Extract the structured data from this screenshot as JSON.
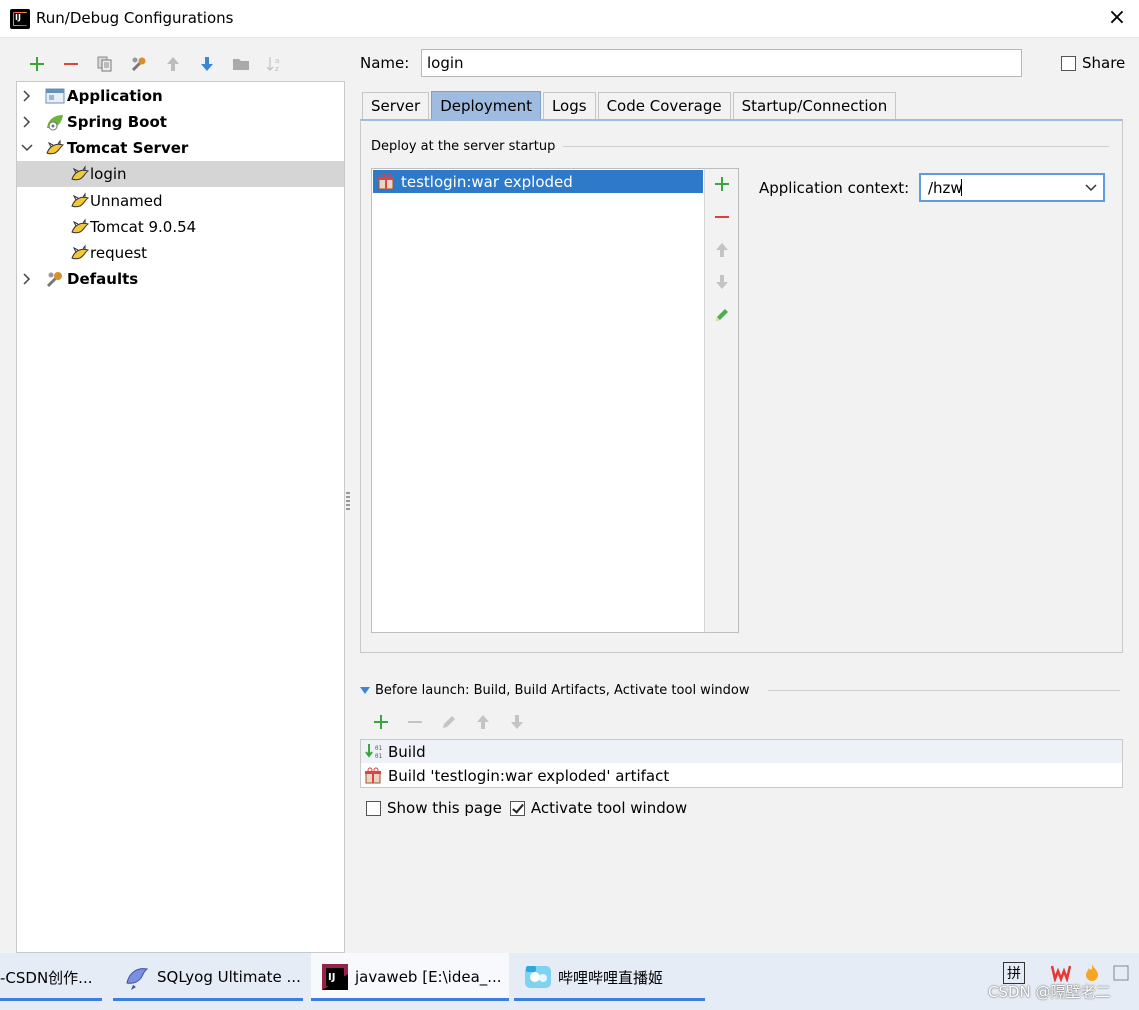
{
  "window": {
    "title": "Run/Debug Configurations",
    "close_label": "×"
  },
  "tree": {
    "items": [
      {
        "label": "Application",
        "bold": true,
        "expanded": false
      },
      {
        "label": "Spring Boot",
        "bold": true,
        "expanded": false
      },
      {
        "label": "Tomcat Server",
        "bold": true,
        "expanded": true
      },
      {
        "label": "login",
        "bold": false,
        "selected": true
      },
      {
        "label": "Unnamed",
        "bold": false
      },
      {
        "label": "Tomcat 9.0.54",
        "bold": false
      },
      {
        "label": "request",
        "bold": false
      },
      {
        "label": "Defaults",
        "bold": true,
        "expanded": false
      }
    ]
  },
  "name_field": {
    "label": "Name:",
    "value": "login"
  },
  "share": {
    "label": "Share",
    "checked": false
  },
  "tabs": [
    {
      "label": "Server",
      "active": false
    },
    {
      "label": "Deployment",
      "active": true
    },
    {
      "label": "Logs",
      "active": false
    },
    {
      "label": "Code Coverage",
      "active": false
    },
    {
      "label": "Startup/Connection",
      "active": false
    }
  ],
  "deployment": {
    "section_title": "Deploy at the server startup",
    "items": [
      "testlogin:war exploded"
    ],
    "context_label": "Application context:",
    "context_value": "/hzw"
  },
  "before_launch": {
    "title": "Before launch: Build, Build Artifacts, Activate tool window",
    "items": [
      "Build",
      "Build 'testlogin:war exploded' artifact"
    ],
    "show_page_label": "Show this page",
    "show_page_checked": false,
    "activate_label": "Activate tool window",
    "activate_checked": true
  },
  "taskbar": {
    "tasks": [
      {
        "label": "-CSDN创作..."
      },
      {
        "label": "SQLyog Ultimate ..."
      },
      {
        "label": "javaweb [E:\\idea_..."
      },
      {
        "label": "哔哩哔哩直播姬"
      }
    ],
    "ime_label": "拼",
    "watermark": "CSDN @隔壁老二"
  },
  "colors": {
    "selection_blue": "#2f7ac8",
    "active_tab": "#9fbbe0",
    "add_green": "#3da53d",
    "remove_red": "#d9453b"
  }
}
